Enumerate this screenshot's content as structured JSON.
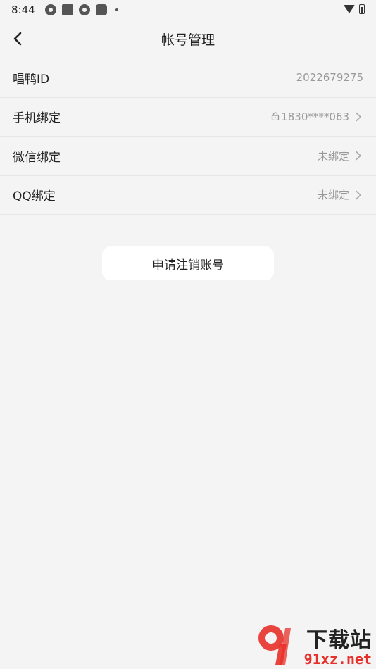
{
  "status_bar": {
    "time": "8:44"
  },
  "header": {
    "title": "帐号管理"
  },
  "rows": [
    {
      "label": "唱鸭ID",
      "value": "2022679275",
      "locked": false,
      "chevron": false
    },
    {
      "label": "手机绑定",
      "value": "1830****063",
      "locked": true,
      "chevron": true
    },
    {
      "label": "微信绑定",
      "value": "未绑定",
      "locked": false,
      "chevron": true
    },
    {
      "label": "QQ绑定",
      "value": "未绑定",
      "locked": false,
      "chevron": true
    }
  ],
  "cancel_account_label": "申请注销账号",
  "watermark": {
    "title": "下载站",
    "url": "91xz.net",
    "accent": "#e8302a"
  }
}
